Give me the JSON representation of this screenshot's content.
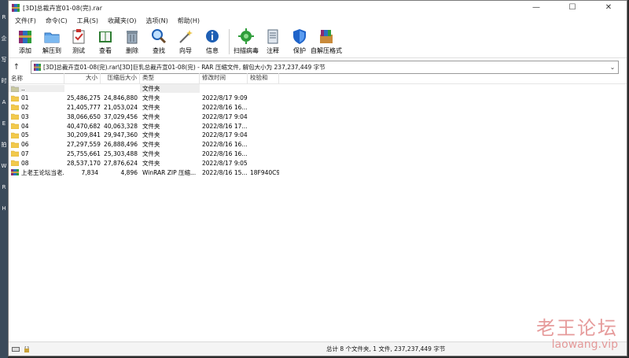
{
  "window": {
    "title": "[3D]总裁卉宣01-08(完).rar",
    "minimize_symbol": "—",
    "maximize_symbol": "☐",
    "close_symbol": "✕"
  },
  "desktop_letters": [
    "R",
    "企",
    "写",
    "时",
    "A",
    "E",
    "拍",
    "W",
    "R",
    "H"
  ],
  "menu": [
    "文件(F)",
    "命令(C)",
    "工具(S)",
    "收藏夹(O)",
    "选项(N)",
    "帮助(H)"
  ],
  "toolbar": [
    {
      "label": "添加",
      "icon": "books-add-icon",
      "color": "#c9302c"
    },
    {
      "label": "解压到",
      "icon": "folder-extract-icon",
      "color": "#3b7dd8"
    },
    {
      "label": "测试",
      "icon": "clipboard-check-icon",
      "color": "#c9302c"
    },
    {
      "label": "查看",
      "icon": "book-view-icon",
      "color": "#2e7d32"
    },
    {
      "label": "删除",
      "icon": "trash-icon",
      "color": "#607080"
    },
    {
      "label": "查找",
      "icon": "magnifier-icon",
      "color": "#1e5fb4"
    },
    {
      "label": "向导",
      "icon": "wand-icon",
      "color": "#888"
    },
    {
      "label": "信息",
      "icon": "info-icon",
      "color": "#1e5fb4"
    },
    {
      "label": "扫描病毒",
      "icon": "virus-scan-icon",
      "color": "#2e9d3a"
    },
    {
      "label": "注释",
      "icon": "comment-icon",
      "color": "#5a6b7c"
    },
    {
      "label": "保护",
      "icon": "shield-icon",
      "color": "#1e63c9"
    },
    {
      "label": "自解压格式",
      "icon": "sfx-icon",
      "color": "#c9302c"
    }
  ],
  "path": {
    "up_symbol": "↑",
    "text": "[3D]总裁卉宣01-08(完).rar\\[3D]巨乳总裁卉宣01-08(完) - RAR 压缩文件, 解包大小为 237,237,449 字节",
    "dropdown_symbol": "⌄"
  },
  "columns": [
    "名称",
    "大小",
    "压缩后大小",
    "类型",
    "修改时间",
    "校验和"
  ],
  "files": [
    {
      "name": "..",
      "size": "",
      "packed": "",
      "type": "文件夹",
      "modified": "",
      "crc": "",
      "kind": "up"
    },
    {
      "name": "01",
      "size": "25,486,275",
      "packed": "24,846,880",
      "type": "文件夹",
      "modified": "2022/8/17 9:09",
      "crc": "",
      "kind": "folder"
    },
    {
      "name": "02",
      "size": "21,405,777",
      "packed": "21,053,024",
      "type": "文件夹",
      "modified": "2022/8/16 16...",
      "crc": "",
      "kind": "folder"
    },
    {
      "name": "03",
      "size": "38,066,650",
      "packed": "37,029,456",
      "type": "文件夹",
      "modified": "2022/8/17 9:04",
      "crc": "",
      "kind": "folder"
    },
    {
      "name": "04",
      "size": "40,470,682",
      "packed": "40,063,328",
      "type": "文件夹",
      "modified": "2022/8/16 17...",
      "crc": "",
      "kind": "folder"
    },
    {
      "name": "05",
      "size": "30,209,841",
      "packed": "29,947,360",
      "type": "文件夹",
      "modified": "2022/8/17 9:04",
      "crc": "",
      "kind": "folder"
    },
    {
      "name": "06",
      "size": "27,297,559",
      "packed": "26,888,496",
      "type": "文件夹",
      "modified": "2022/8/16 16...",
      "crc": "",
      "kind": "folder"
    },
    {
      "name": "07",
      "size": "25,755,661",
      "packed": "25,303,488",
      "type": "文件夹",
      "modified": "2022/8/16 16...",
      "crc": "",
      "kind": "folder"
    },
    {
      "name": "08",
      "size": "28,537,170",
      "packed": "27,876,624",
      "type": "文件夹",
      "modified": "2022/8/17 9:05",
      "crc": "",
      "kind": "folder"
    },
    {
      "name": "上老王论坛当老...",
      "size": "7,834",
      "packed": "4,896",
      "type": "WinRAR ZIP 压缩...",
      "modified": "2022/8/16 15...",
      "crc": "18F940C9",
      "kind": "zip"
    }
  ],
  "status": {
    "text": "总计 8 个文件夹, 1 文件, 237,237,449 字节"
  },
  "watermark": {
    "line1": "老王论坛",
    "line2": "laowang.vip"
  }
}
